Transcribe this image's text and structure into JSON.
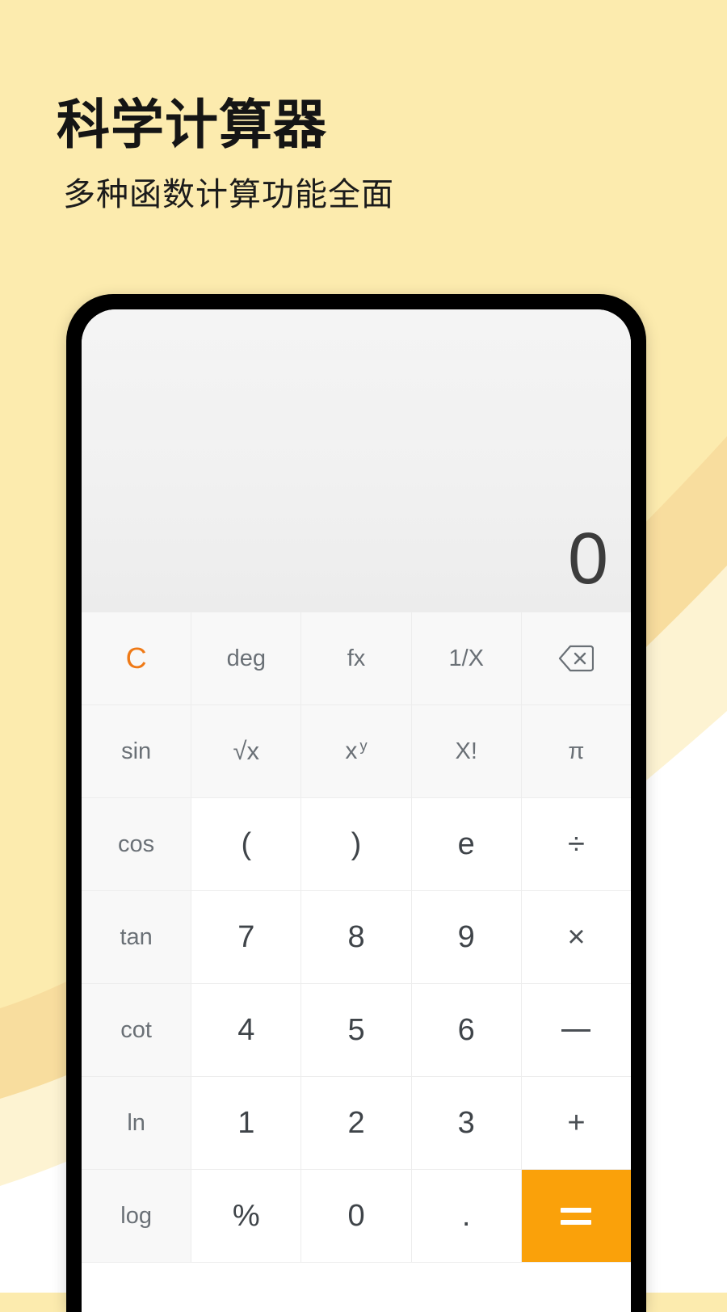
{
  "theme": {
    "page_bg": "#FCEBAE",
    "wave_mid": "#F8DD9E",
    "wave_light": "#FDF3D2",
    "wave_white": "#FFFFFF",
    "accent_orange": "#FAA10A",
    "clear_orange": "#EF7A17",
    "bezel": "#000000"
  },
  "headline": {
    "title": "科学计算器",
    "subtitle": "多种函数计算功能全面"
  },
  "calculator": {
    "display": {
      "value": "0"
    },
    "rows": [
      [
        {
          "label": "C",
          "name": "key-clear",
          "kind": "clear"
        },
        {
          "label": "deg",
          "name": "key-deg",
          "kind": "fn-small"
        },
        {
          "label": "fx",
          "name": "key-fx",
          "kind": "fn-small"
        },
        {
          "label": "1/X",
          "name": "key-reciprocal",
          "kind": "fn-small"
        },
        {
          "label": "",
          "name": "key-backspace",
          "kind": "icon-backspace"
        }
      ],
      [
        {
          "label": "sin",
          "name": "key-sin",
          "kind": "fn-small"
        },
        {
          "label": "√x",
          "name": "key-sqrt",
          "kind": "sqrt"
        },
        {
          "label": "x",
          "sup": "y",
          "name": "key-power",
          "kind": "power"
        },
        {
          "label": "X!",
          "name": "key-factorial",
          "kind": "fn-small"
        },
        {
          "label": "π",
          "name": "key-pi",
          "kind": "fn-small"
        }
      ],
      [
        {
          "label": "cos",
          "name": "key-cos",
          "kind": "fn-small"
        },
        {
          "label": "(",
          "name": "key-paren-open",
          "kind": "digit"
        },
        {
          "label": ")",
          "name": "key-paren-close",
          "kind": "digit"
        },
        {
          "label": "e",
          "name": "key-euler",
          "kind": "digit"
        },
        {
          "label": "÷",
          "name": "key-divide",
          "kind": "op"
        }
      ],
      [
        {
          "label": "tan",
          "name": "key-tan",
          "kind": "fn-small"
        },
        {
          "label": "7",
          "name": "key-7",
          "kind": "digit"
        },
        {
          "label": "8",
          "name": "key-8",
          "kind": "digit"
        },
        {
          "label": "9",
          "name": "key-9",
          "kind": "digit"
        },
        {
          "label": "×",
          "name": "key-multiply",
          "kind": "op"
        }
      ],
      [
        {
          "label": "cot",
          "name": "key-cot",
          "kind": "fn-small"
        },
        {
          "label": "4",
          "name": "key-4",
          "kind": "digit"
        },
        {
          "label": "5",
          "name": "key-5",
          "kind": "digit"
        },
        {
          "label": "6",
          "name": "key-6",
          "kind": "digit"
        },
        {
          "label": "−",
          "name": "key-subtract",
          "kind": "minus"
        }
      ],
      [
        {
          "label": "ln",
          "name": "key-ln",
          "kind": "fn-small"
        },
        {
          "label": "1",
          "name": "key-1",
          "kind": "digit"
        },
        {
          "label": "2",
          "name": "key-2",
          "kind": "digit"
        },
        {
          "label": "3",
          "name": "key-3",
          "kind": "digit"
        },
        {
          "label": "+",
          "name": "key-add",
          "kind": "op"
        }
      ],
      [
        {
          "label": "log",
          "name": "key-log",
          "kind": "fn-small"
        },
        {
          "label": "%",
          "name": "key-percent",
          "kind": "digit"
        },
        {
          "label": "0",
          "name": "key-0",
          "kind": "digit"
        },
        {
          "label": ".",
          "name": "key-decimal",
          "kind": "digit"
        },
        {
          "label": "=",
          "name": "key-equals",
          "kind": "equals"
        }
      ]
    ]
  }
}
